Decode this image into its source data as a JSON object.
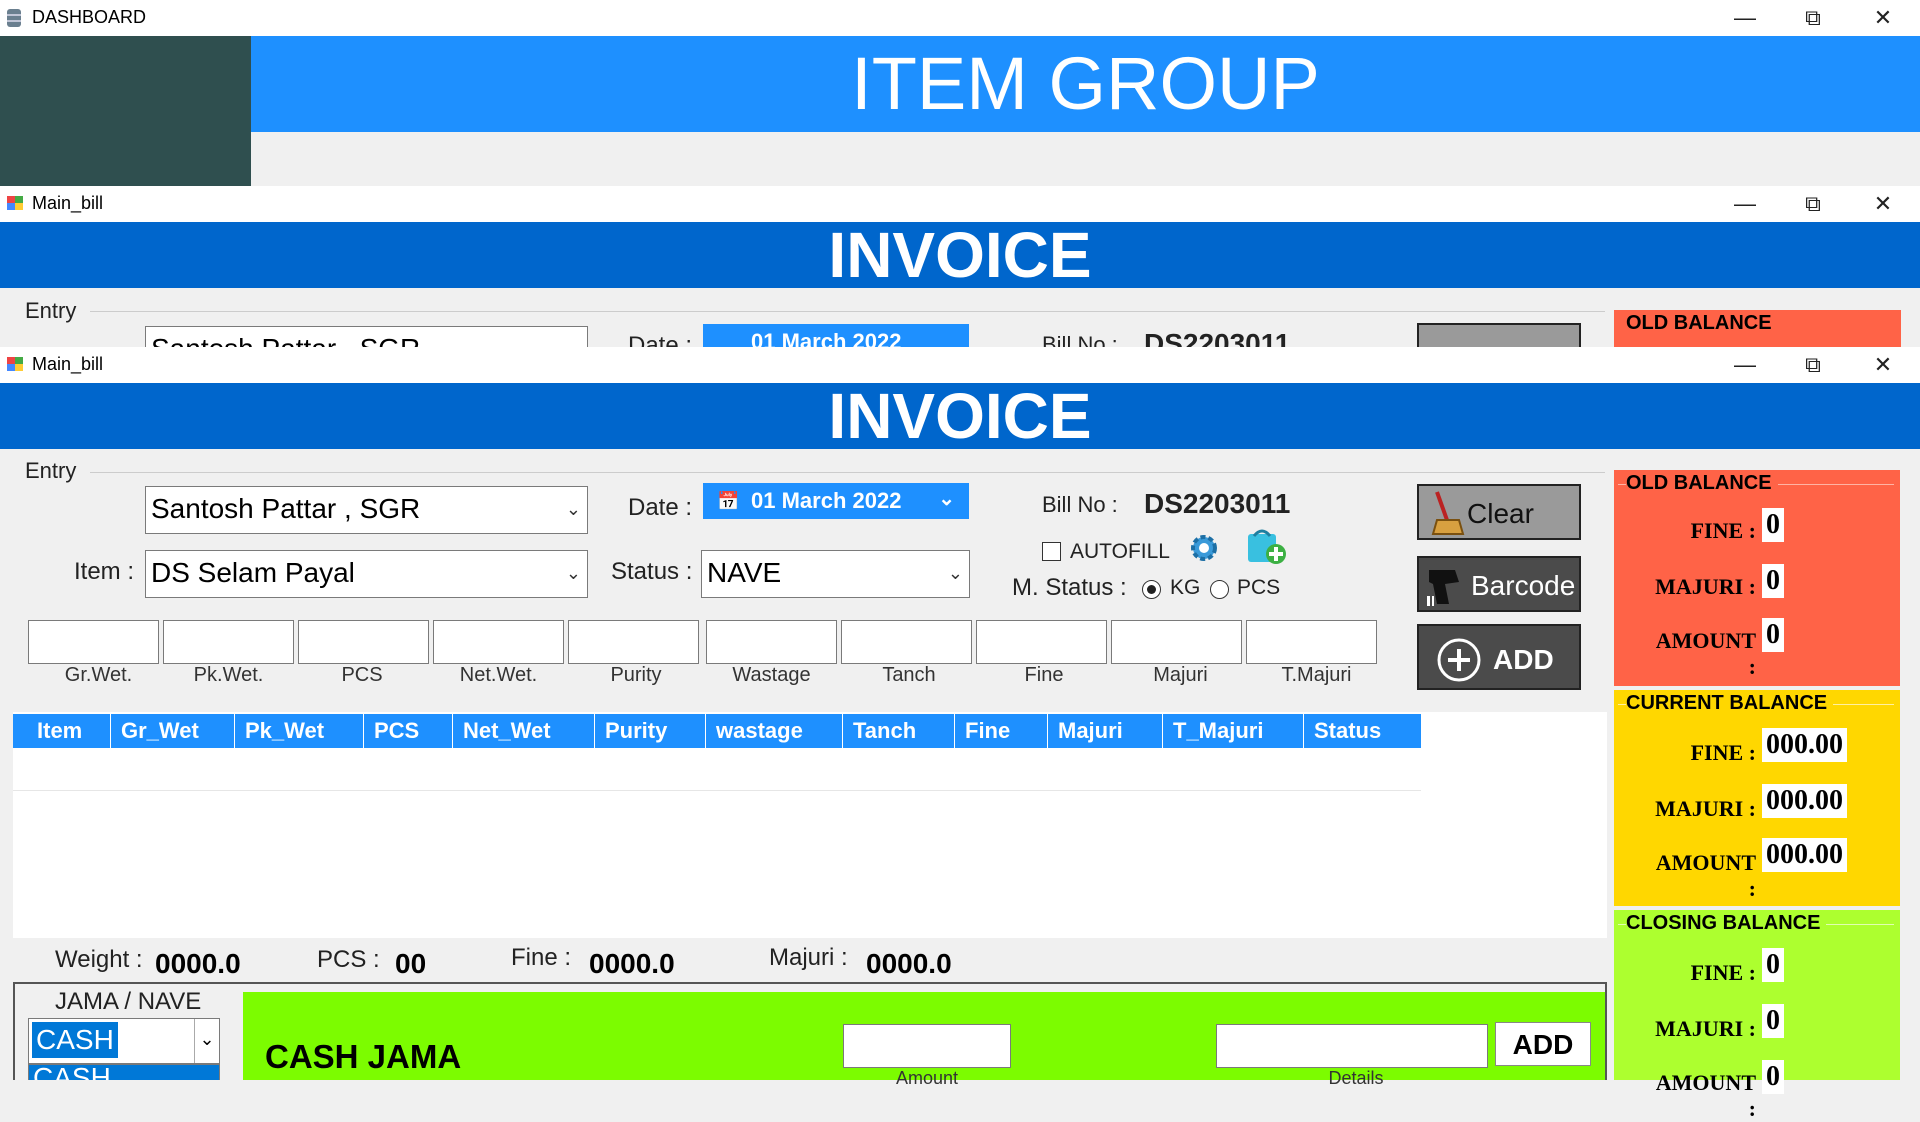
{
  "dashboard": {
    "window_title": "DASHBOARD",
    "banner": "ITEM GROUP"
  },
  "bg_window": {
    "title": "Main_bill",
    "banner": "INVOICE",
    "entry_label": "Entry",
    "customer": "Santosh Pattar , SGR",
    "date_label": "Date :",
    "date_value": "01 March 2022",
    "bill_label": "Bill No :",
    "bill_value": "DS2203011",
    "old_balance": "OLD BALANCE"
  },
  "window": {
    "title": "Main_bill",
    "banner": "INVOICE"
  },
  "entry": {
    "group_label": "Entry",
    "customer_value": "Santosh Pattar , SGR",
    "item_label": "Item :",
    "item_value": "DS Selam Payal",
    "date_label": "Date :",
    "date_value": "01 March 2022",
    "status_label": "Status :",
    "status_value": "NAVE",
    "bill_label": "Bill No :",
    "bill_value": "DS2203011",
    "autofill_label": "AUTOFILL",
    "mstatus_label": "M. Status :",
    "radio_kg": "KG",
    "radio_pcs": "PCS"
  },
  "fields": [
    "Gr.Wet.",
    "Pk.Wet.",
    "PCS",
    "Net.Wet.",
    "Purity",
    "Wastage",
    "Tanch",
    "Fine",
    "Majuri",
    "T.Majuri"
  ],
  "buttons": {
    "clear": "Clear",
    "barcode": "Barcode",
    "add": "ADD"
  },
  "table": {
    "columns": [
      "Item",
      "Gr_Wet",
      "Pk_Wet",
      "PCS",
      "Net_Wet",
      "Purity",
      "wastage",
      "Tanch",
      "Fine",
      "Majuri",
      "T_Majuri",
      "Status"
    ]
  },
  "totals": {
    "weight_label": "Weight :",
    "weight_value": "0000.0",
    "pcs_label": "PCS :",
    "pcs_value": "00",
    "fine_label": "Fine :",
    "fine_value": "0000.0",
    "majuri_label": "Majuri :",
    "majuri_value": "0000.0"
  },
  "jama": {
    "label": "JAMA / NAVE",
    "select_value": "CASH",
    "dropdown_peek": "CASH",
    "title": "CASH JAMA",
    "amount_label": "Amount",
    "details_label": "Details",
    "add_label": "ADD"
  },
  "balances": {
    "old": {
      "title": "OLD BALANCE",
      "fine_label": "FINE :",
      "fine": "0",
      "majuri_label": "MAJURI :",
      "majuri": "0",
      "amount_label": "AMOUNT :",
      "amount": "0"
    },
    "current": {
      "title": "CURRENT BALANCE",
      "fine_label": "FINE :",
      "fine": "000.00",
      "majuri_label": "MAJURI :",
      "majuri": "000.00",
      "amount_label": "AMOUNT :",
      "amount": "000.00"
    },
    "closing": {
      "title": "CLOSING BALANCE",
      "fine_label": "FINE :",
      "fine": "0",
      "majuri_label": "MAJURI :",
      "majuri": "0",
      "amount_label": "AMOUNT :",
      "amount": "0"
    }
  },
  "colors": {
    "dashboard_banner": "#1e90ff",
    "dashboard_side": "#2f4f4f",
    "invoice_banner": "#0066cc",
    "table_header": "#1e90ff",
    "old_balance": "#ff6347",
    "current_balance": "#ffd700",
    "closing_balance": "#adff2f",
    "cash_jama": "#7cfc00"
  }
}
